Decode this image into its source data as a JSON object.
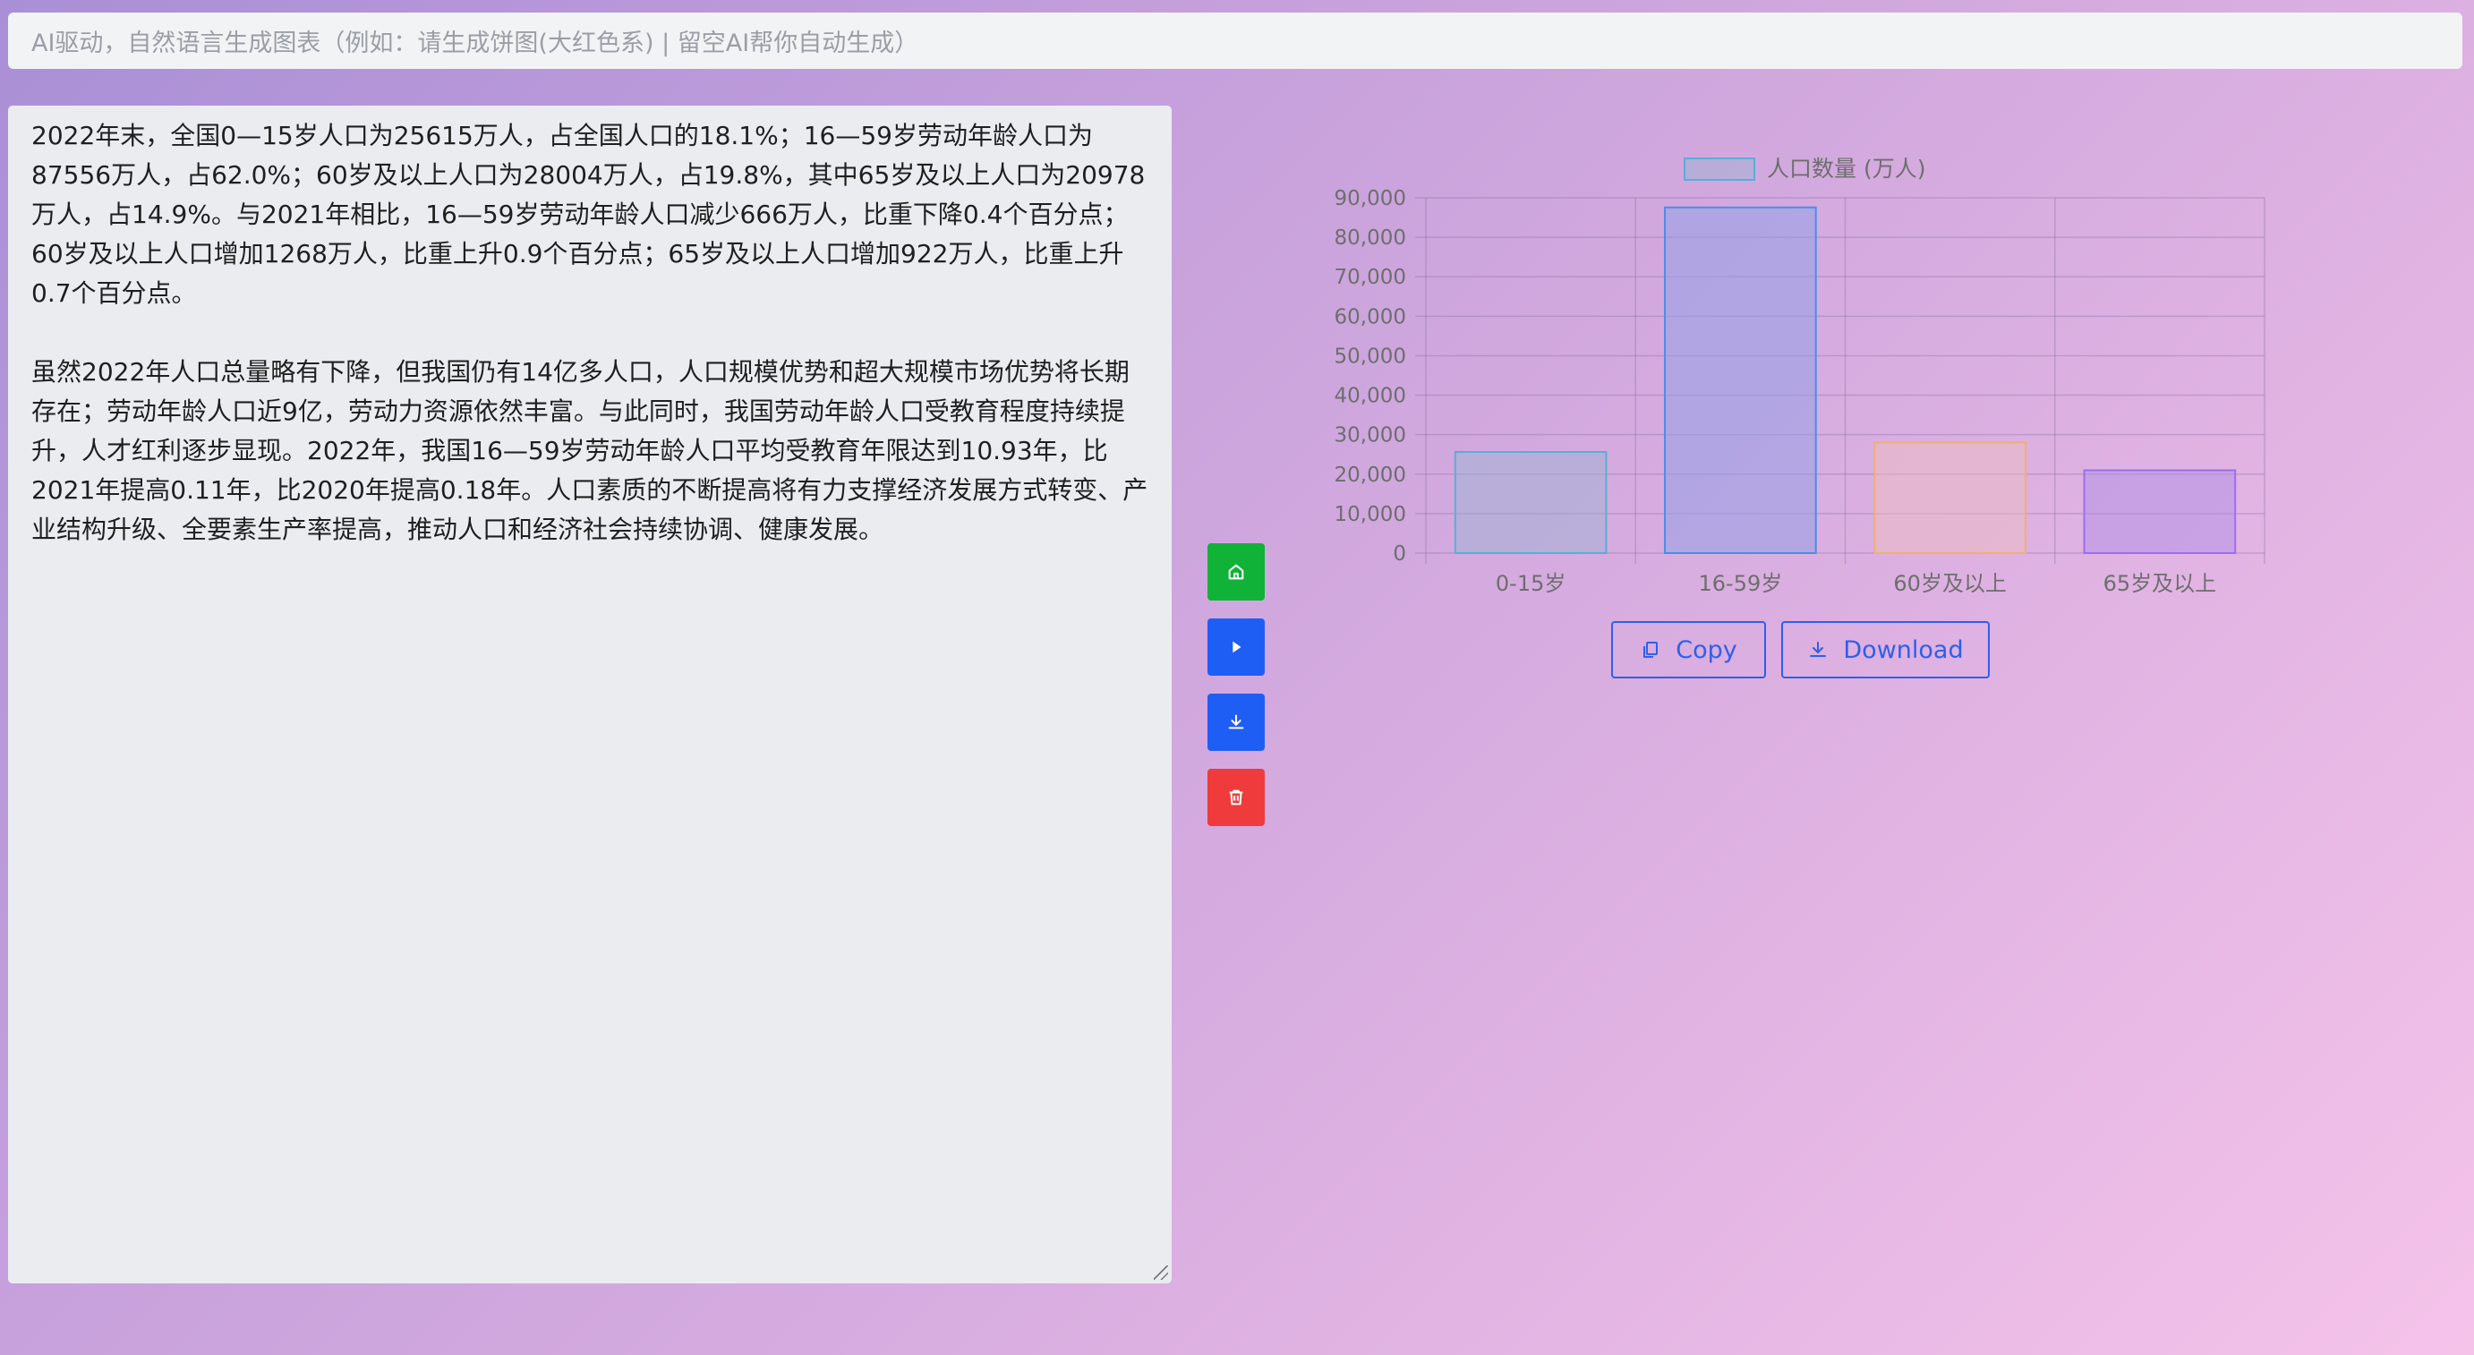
{
  "prompt": {
    "placeholder": "AI驱动，自然语言生成图表（例如：请生成饼图(大红色系) | 留空AI帮你自动生成）"
  },
  "editor": {
    "paragraphs": [
      "2022年末，全国0—15岁人口为25615万人，占全国人口的18.1%；16—59岁劳动年龄人口为87556万人，占62.0%；60岁及以上人口为28004万人，占19.8%，其中65岁及以上人口为20978万人，占14.9%。与2021年相比，16—59岁劳动年龄人口减少666万人，比重下降0.4个百分点；60岁及以上人口增加1268万人，比重上升0.9个百分点；65岁及以上人口增加922万人，比重上升0.7个百分点。",
      "虽然2022年人口总量略有下降，但我国仍有14亿多人口，人口规模优势和超大规模市场优势将长期存在；劳动年龄人口近9亿，劳动力资源依然丰富。与此同时，我国劳动年龄人口受教育程度持续提升，人才红利逐步显现。2022年，我国16—59岁劳动年龄人口平均受教育年限达到10.93年，比2021年提高0.11年，比2020年提高0.18年。人口素质的不断提高将有力支撑经济发展方式转变、产业结构升级、全要素生产率提高，推动人口和经济社会持续协调、健康发展。"
    ]
  },
  "side_buttons": {
    "home_icon": "home-icon",
    "run_icon": "play-icon",
    "download_icon": "download-icon",
    "delete_icon": "trash-icon",
    "colors": {
      "home": "#11b238",
      "run": "#1f5ef5",
      "download": "#1f5ef5",
      "delete": "#ef3b3b"
    }
  },
  "actions": {
    "copy_label": "Copy",
    "download_label": "Download"
  },
  "chart_data": {
    "type": "bar",
    "categories": [
      "0-15岁",
      "16-59岁",
      "60岁及以上",
      "65岁及以上"
    ],
    "series": [
      {
        "name": "人口数量 (万人)",
        "values": [
          25615,
          87556,
          28004,
          20978
        ]
      }
    ],
    "ylim": [
      0,
      90000
    ],
    "yticks": [
      0,
      10000,
      20000,
      30000,
      40000,
      50000,
      60000,
      70000,
      80000,
      90000
    ],
    "ytick_labels": [
      "0",
      "10,000",
      "20,000",
      "30,000",
      "40,000",
      "50,000",
      "60,000",
      "70,000",
      "80,000",
      "90,000"
    ],
    "grid": true,
    "legend": "top-center",
    "bar_colors": [
      {
        "fill": "rgba(150,180,210,0.45)",
        "stroke": "#5aaed8"
      },
      {
        "fill": "rgba(150,160,230,0.55)",
        "stroke": "#4a8fe0"
      },
      {
        "fill": "rgba(240,190,190,0.45)",
        "stroke": "#f0b070"
      },
      {
        "fill": "rgba(170,140,230,0.45)",
        "stroke": "#9b6ef0"
      }
    ],
    "legend_swatch": {
      "fill": "rgba(150,180,210,0.45)",
      "stroke": "#5aaed8"
    }
  }
}
